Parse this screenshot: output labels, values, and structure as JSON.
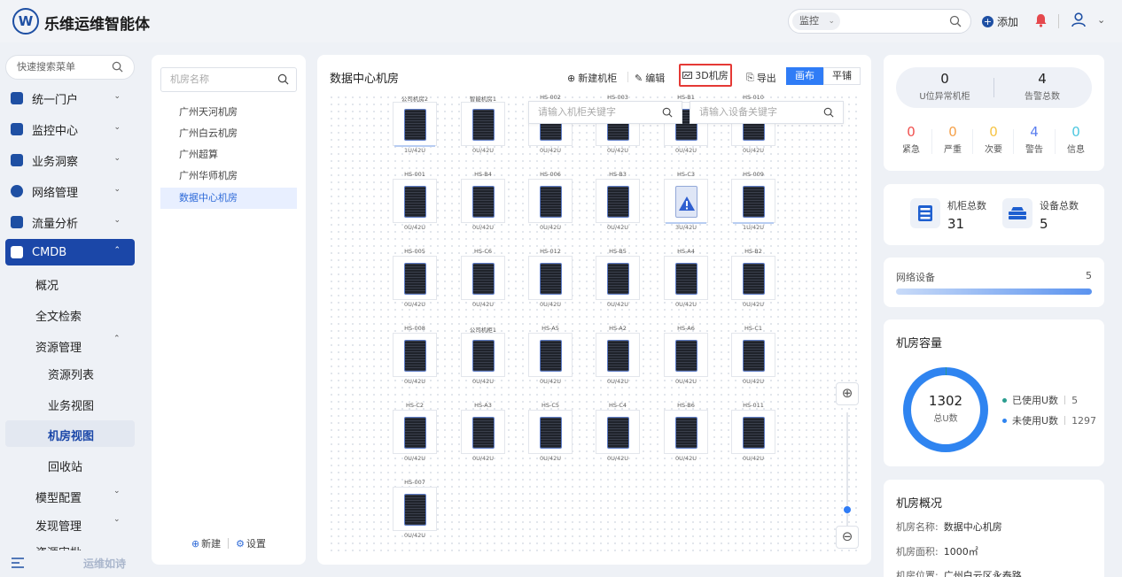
{
  "header": {
    "logo_letter": "W",
    "brand": "乐维运维智能体",
    "search_scope": "监控",
    "add_label": "添加"
  },
  "nav": {
    "search_placeholder": "快速搜索菜单",
    "items": [
      {
        "label": "统一门户"
      },
      {
        "label": "监控中心"
      },
      {
        "label": "业务洞察"
      },
      {
        "label": "网络管理"
      },
      {
        "label": "流量分析"
      },
      {
        "label": "CMDB"
      }
    ],
    "cmdb_children": [
      "概况",
      "全文检索",
      "资源管理"
    ],
    "resource_children": [
      "资源列表",
      "业务视图",
      "机房视图",
      "回收站"
    ],
    "more_items": [
      "模型配置",
      "发现管理",
      "资源审批"
    ],
    "footer_text": "运维如诗"
  },
  "room_panel": {
    "search_placeholder": "机房名称",
    "rooms": [
      "广州天河机房",
      "广州白云机房",
      "广州超算",
      "广州华师机房",
      "数据中心机房"
    ],
    "new_label": "新建",
    "settings_label": "设置"
  },
  "main": {
    "title": "数据中心机房",
    "toolbar": {
      "new_rack": "新建机柜",
      "edit": "编辑",
      "view_3d": "3D机房",
      "export": "导出",
      "canvas": "画布",
      "tile": "平铺"
    },
    "rack_search_placeholder": "请输入机柜关键字",
    "device_search_placeholder": "请输入设备关键字",
    "racks": [
      [
        {
          "name": "公司机房2",
          "cap": "1U/42U",
          "used": true
        },
        {
          "name": "智能机房1",
          "cap": "0U/42U"
        },
        {
          "name": "HS-002",
          "cap": "0U/42U"
        },
        {
          "name": "HS-003",
          "cap": "0U/42U"
        },
        {
          "name": "HS-B1",
          "cap": "0U/42U"
        },
        {
          "name": "HS-010",
          "cap": "0U/42U"
        }
      ],
      [
        {
          "name": "HS-001",
          "cap": "0U/42U"
        },
        {
          "name": "HS-B4",
          "cap": "0U/42U"
        },
        {
          "name": "HS-006",
          "cap": "0U/42U"
        },
        {
          "name": "HS-B3",
          "cap": "0U/42U"
        },
        {
          "name": "HS-C3",
          "cap": "3U/42U",
          "alert": true
        },
        {
          "name": "HS-009",
          "cap": "1U/42U",
          "used": true
        }
      ],
      [
        {
          "name": "HS-005",
          "cap": "0U/42U"
        },
        {
          "name": "HS-C6",
          "cap": "0U/42U"
        },
        {
          "name": "HS-012",
          "cap": "0U/42U"
        },
        {
          "name": "HS-B5",
          "cap": "0U/42U"
        },
        {
          "name": "HS-A4",
          "cap": "0U/42U"
        },
        {
          "name": "HS-B2",
          "cap": "0U/42U"
        }
      ],
      [
        {
          "name": "HS-008",
          "cap": "0U/42U"
        },
        {
          "name": "公司机柜1",
          "cap": "0U/42U"
        },
        {
          "name": "HS-A5",
          "cap": "0U/42U"
        },
        {
          "name": "HS-A2",
          "cap": "0U/42U"
        },
        {
          "name": "HS-A6",
          "cap": "0U/42U"
        },
        {
          "name": "HS-C1",
          "cap": "0U/42U"
        }
      ],
      [
        {
          "name": "HS-C2",
          "cap": "0U/42U"
        },
        {
          "name": "HS-A3",
          "cap": "0U/42U"
        },
        {
          "name": "HS-C5",
          "cap": "0U/42U"
        },
        {
          "name": "HS-C4",
          "cap": "0U/42U"
        },
        {
          "name": "HS-B6",
          "cap": "0U/42U"
        },
        {
          "name": "HS-011",
          "cap": "0U/42U"
        }
      ],
      [
        {
          "name": "HS-007",
          "cap": "0U/42U"
        }
      ]
    ]
  },
  "alarms": {
    "abnormal_racks": {
      "value": "0",
      "label": "U位异常机柜"
    },
    "total_alarms": {
      "value": "4",
      "label": "告警总数"
    },
    "levels": [
      {
        "label": "紧急",
        "value": "0",
        "color": "#f0504e"
      },
      {
        "label": "严重",
        "value": "0",
        "color": "#f5a14a"
      },
      {
        "label": "次要",
        "value": "0",
        "color": "#f6c445"
      },
      {
        "label": "警告",
        "value": "4",
        "color": "#5b7ff0"
      },
      {
        "label": "信息",
        "value": "0",
        "color": "#4cc7e0"
      }
    ]
  },
  "totals": {
    "rack_label": "机柜总数",
    "rack_value": "31",
    "device_label": "设备总数",
    "device_value": "5"
  },
  "network": {
    "label": "网络设备",
    "value": "5"
  },
  "capacity": {
    "title": "机房容量",
    "total": "1302",
    "total_label": "总U数",
    "used_label": "已使用U数",
    "used": "5",
    "unused_label": "未使用U数",
    "unused": "1297",
    "colors": {
      "used": "#2a9d8f",
      "unused": "#2f84f0"
    }
  },
  "overview": {
    "title": "机房概况",
    "rows": [
      {
        "k": "机房名称:",
        "v": "数据中心机房"
      },
      {
        "k": "机房面积:",
        "v": "1000㎡"
      },
      {
        "k": "机房位置:",
        "v": "广州白云区永泰路"
      }
    ]
  }
}
